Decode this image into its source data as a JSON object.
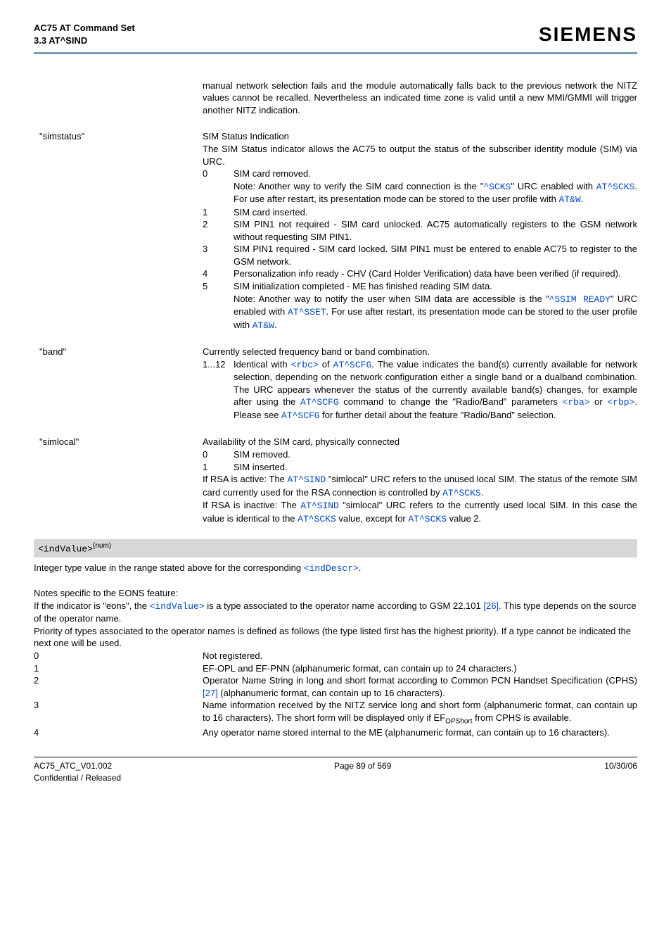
{
  "header": {
    "title_line1": "AC75 AT Command Set",
    "title_line2": "3.3 AT^SIND",
    "brand": "SIEMENS"
  },
  "intro_block": {
    "text_parts": [
      "manual network selection fails and the module automatically falls back to the previous network the NITZ values cannot be recalled. Nevertheless an indicated time zone is valid until a new MMI/GMMI will trigger another NITZ indication."
    ]
  },
  "sections": [
    {
      "key": "\"simstatus\"",
      "lead_paras": [
        "SIM Status Indication",
        "The SIM Status indicator allows the AC75 to output the status of the subscriber identity module (SIM) via URC."
      ],
      "items": [
        {
          "n": "0",
          "pre": "SIM card removed.",
          "note_before": "Note: Another way to verify the SIM card connection is the \"",
          "link1": "^SCKS",
          "mid1": "\" URC enabled with ",
          "link2": "AT^SCKS",
          "mid2": ". For use after restart, its presentation mode can be stored to the user profile with ",
          "link3": "AT&W",
          "tail": "."
        },
        {
          "n": "1",
          "plain": "SIM card inserted."
        },
        {
          "n": "2",
          "plain": "SIM PIN1 not required - SIM card unlocked. AC75 automatically registers to the GSM network without requesting SIM PIN1."
        },
        {
          "n": "3",
          "plain": "SIM PIN1 required - SIM card locked. SIM PIN1 must be entered to enable AC75 to register to the GSM network."
        },
        {
          "n": "4",
          "plain": "Personalization info ready - CHV (Card Holder Verification) data have been verified (if required)."
        },
        {
          "n": "5",
          "pre": "SIM initialization completed - ME has finished reading SIM data.",
          "note_before": "Note: Another way to notify the user when SIM data are accessible is the \"",
          "link1": "^SSIM READY",
          "mid1": "\" URC enabled with ",
          "link2": "AT^SSET",
          "mid2": ". For use after restart, its presentation mode can be stored to the user profile with ",
          "link3": "AT&W",
          "tail": "."
        }
      ]
    },
    {
      "key": "\"band\"",
      "lead_paras": [
        "Currently selected frequency band or band combination."
      ],
      "items": [
        {
          "n": "1...12",
          "composed": true,
          "p1": "Identical with ",
          "l1": "<rbc>",
          "p2": " of ",
          "l2": "AT^SCFG",
          "p3": ". The value indicates the band(s) currently available for network selection, depending on the network configuration either a single band or a dualband combination. The URC appears whenever the status of the currently available band(s) changes, for example after using the ",
          "l3": "AT^SCFG",
          "p4": " command to change the \"Radio/Band\" parameters ",
          "l4": "<rba>",
          "p5": " or ",
          "l5": "<rbp>",
          "p6": ". Please see ",
          "l6": "AT^SCFG",
          "p7": " for further detail about the feature \"Radio/Band\" selection."
        }
      ]
    },
    {
      "key": "\"simlocal\"",
      "lead_paras": [
        "Availability of the SIM card, physically connected"
      ],
      "items": [
        {
          "n": "0",
          "plain": "SIM removed."
        },
        {
          "n": "1",
          "plain": "SIM inserted."
        }
      ],
      "trailing": {
        "t1a": "If RSA is active: The ",
        "l1": "AT^SIND",
        "t1b": " \"simlocal\" URC refers to the unused local SIM. The status of the remote SIM card currently used for the RSA connection is controlled by ",
        "l2": "AT^SCKS",
        "t1c": ".",
        "t2a": "If RSA is inactive: The ",
        "l3": "AT^SIND",
        "t2b": " \"simlocal\" URC refers to the currently used local SIM. In this case the value is identical to the ",
        "l4": "AT^SCKS",
        "t2c": " value, except for ",
        "l5": "AT^SCKS",
        "t2d": " value 2."
      }
    }
  ],
  "param": {
    "name_open": "<indValue>",
    "sup": "(num)",
    "desc_a": "Integer type value in the range stated above for the corresponding ",
    "desc_link": "<indDescr>",
    "desc_b": "."
  },
  "eons": {
    "heading": "Notes specific to the EONS feature:",
    "line1a": " If the indicator is \"eons\", the ",
    "line1_link": "<indValue>",
    "line1b": " is a type associated to the operator name according to GSM 22.101 ",
    "ref1": "[26]",
    "line1c": ". This type depends on the source of the operator name.",
    "line2": "Priority of types associated to the operator names is defined as follows (the type listed first has the highest priority). If a type cannot be indicated the next one will be used.",
    "rows": [
      {
        "n": "0",
        "plain": "Not registered."
      },
      {
        "n": "1",
        "plain": "EF-OPL and EF-PNN (alphanumeric format, can contain up to 24 characters.)"
      },
      {
        "n": "2",
        "t1": "Operator Name String in long and short format according to Common PCN Handset Specification (CPHS) ",
        "ref": "[27]",
        "t2": " (alphanumeric format, can contain up to 16 characters)."
      },
      {
        "n": "3",
        "t1": "Name information received by the NITZ service long and short form (alphanumeric format, can contain up to 16 characters). The short form will be displayed only if EF",
        "sub": "OPShort",
        "t2": " from CPHS is available."
      },
      {
        "n": "4",
        "plain": "Any operator name stored internal to the ME (alphanumeric format, can contain up to 16 characters)."
      }
    ]
  },
  "footer": {
    "left1": "AC75_ATC_V01.002",
    "left2": "Confidential / Released",
    "center": "Page 89 of 569",
    "right": "10/30/06"
  }
}
